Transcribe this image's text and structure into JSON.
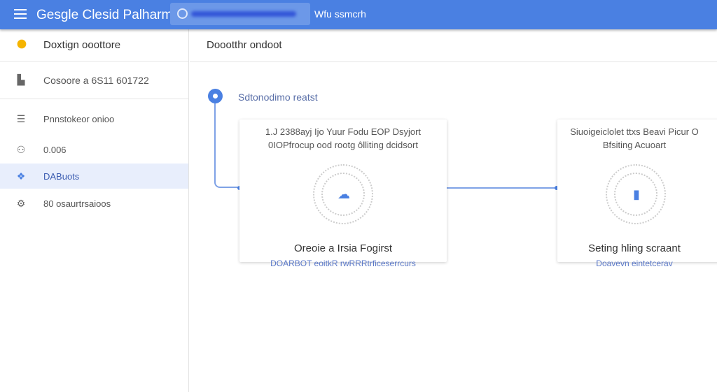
{
  "header": {
    "title": "Gesgle Clesid Palharm",
    "search_label": "Wfu ssmcrh"
  },
  "sidebar": {
    "project": "Doxtign ooottore",
    "summary": "Cosoore a 6S11 601722",
    "items": [
      {
        "label": "Pnnstokeor onioo",
        "icon": "list-icon"
      },
      {
        "label": "0.006",
        "icon": "chip-icon"
      },
      {
        "label": "DABuots",
        "icon": "apps-icon",
        "selected": true
      },
      {
        "label": "80 osaurtrsaioos",
        "icon": "settings-icon"
      }
    ]
  },
  "main": {
    "title": "Doootthr ondoot",
    "step_label": "Sdtonodimo reatst",
    "cards": [
      {
        "desc1": "1.J 2388ayj Ijo Yuur Fodu EOP Dsyjort",
        "desc2": "0IOPfrocup ood rootg ôlliting dcidsort",
        "title": "Oreoie a Irsia Fogirst",
        "link": "DOARBOT eoitkR rwRRRtrficeserrcurs",
        "icon": "cloud-icon"
      },
      {
        "desc1": "Siuoigeiclolet ttxs Beavi Picur O",
        "desc2": "Bfsiting Acuoart",
        "title": "Seting hling scraant",
        "link": "Doavevn eintetcerav",
        "icon": "card-icon"
      }
    ]
  },
  "colors": {
    "accent": "#4a80e2",
    "selected_bg": "#e8eefc"
  }
}
